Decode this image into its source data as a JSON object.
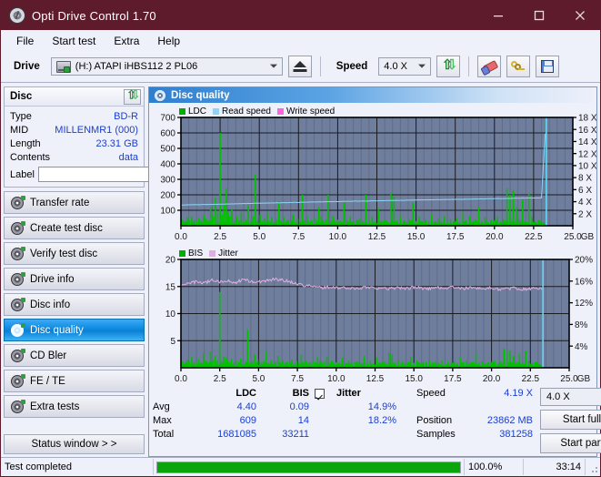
{
  "window": {
    "title": "Opti Drive Control 1.70",
    "icon": "disc-icon",
    "minimize": "minimize-icon",
    "maximize": "maximize-icon",
    "close": "close-icon"
  },
  "menu": {
    "items": [
      "File",
      "Start test",
      "Extra",
      "Help"
    ]
  },
  "toolbar": {
    "drive_label": "Drive",
    "drive_value": "(H:)  ATAPI iHBS112  2 PL06",
    "eject_icon": "eject-icon",
    "speed_label": "Speed",
    "speed_value": "4.0 X",
    "refresh_icon": "refresh-arrows-icon",
    "erase_icon": "eraser-icon",
    "keys_icon": "keys-icon",
    "save_icon": "floppy-save-icon"
  },
  "disc": {
    "header": "Disc",
    "refresh_icon": "refresh-arrows-icon",
    "rows": [
      {
        "label": "Type",
        "value": "BD-R"
      },
      {
        "label": "MID",
        "value": "MILLENMR1 (000)"
      },
      {
        "label": "Length",
        "value": "23.31 GB"
      },
      {
        "label": "Contents",
        "value": "data"
      }
    ],
    "label_label": "Label",
    "label_value": "",
    "label_placeholder": "",
    "disc_button_icon": "cd-disc-icon"
  },
  "sidebar": {
    "items": [
      {
        "label": "Transfer rate",
        "active": false
      },
      {
        "label": "Create test disc",
        "active": false
      },
      {
        "label": "Verify test disc",
        "active": false
      },
      {
        "label": "Drive info",
        "active": false
      },
      {
        "label": "Disc info",
        "active": false
      },
      {
        "label": "Disc quality",
        "active": true
      },
      {
        "label": "CD Bler",
        "active": false
      },
      {
        "label": "FE / TE",
        "active": false
      },
      {
        "label": "Extra tests",
        "active": false
      }
    ],
    "status_window": "Status window > >"
  },
  "main": {
    "title": "Disc quality",
    "icon": "disc-quality-icon"
  },
  "stats": {
    "col_headers": [
      "LDC",
      "BIS"
    ],
    "jitter_label": "Jitter",
    "jitter_checked": true,
    "rows": [
      {
        "label": "Avg",
        "ldc": "4.40",
        "bis": "0.09",
        "jitter": "14.9%"
      },
      {
        "label": "Max",
        "ldc": "609",
        "bis": "14",
        "jitter": "18.2%"
      },
      {
        "label": "Total",
        "ldc": "1681085",
        "bis": "33211",
        "jitter": ""
      }
    ],
    "speed_label": "Speed",
    "speed_value": "4.19 X",
    "position_label": "Position",
    "position_value": "23862 MB",
    "samples_label": "Samples",
    "samples_value": "381258",
    "speed_select": "4.0 X",
    "start_full": "Start full",
    "start_part": "Start part"
  },
  "statusbar": {
    "message": "Test completed",
    "progress_percent": "100.0%",
    "progress_value": 100,
    "elapsed": "33:14"
  },
  "colors": {
    "titlebar": "#5e1b2c",
    "accent": "#0a8ae0",
    "ldc": "#00c000",
    "bis": "#00c000",
    "read_speed": "#8fd4f5",
    "write_speed": "#ff66dd",
    "jitter": "#e8b6e8",
    "plot_bg": "#6e7e9c",
    "value_text": "#1a3fd0",
    "progress": "#0aa50a"
  },
  "chart_data": [
    {
      "type": "bar",
      "name": "ldc-chart",
      "title": "",
      "legend": [
        {
          "label": "LDC",
          "color": "#00b000"
        },
        {
          "label": "Read speed",
          "color": "#8fd4f5"
        },
        {
          "label": "Write speed",
          "color": "#ff66dd"
        }
      ],
      "legend_position": "top-left",
      "xlabel": "GB",
      "ylabel": "",
      "xlim": [
        0,
        25
      ],
      "ylim": [
        0,
        700
      ],
      "y2lim": [
        0,
        18
      ],
      "y2label": "X",
      "xticks": [
        "0.0",
        "2.5",
        "5.0",
        "7.5",
        "10.0",
        "12.5",
        "15.0",
        "17.5",
        "20.0",
        "22.5",
        "25.0"
      ],
      "yticks": [
        100,
        200,
        300,
        400,
        500,
        600,
        700
      ],
      "y2ticks": [
        "2 X",
        "4 X",
        "6 X",
        "8 X",
        "10 X",
        "12 X",
        "14 X",
        "16 X",
        "18 X"
      ],
      "grid": true,
      "data_end_gb": 23.31,
      "series": [
        {
          "name": "LDC",
          "kind": "bars",
          "color": "#00c000",
          "x": [
            0.1,
            0.25,
            0.4,
            0.55,
            0.7,
            0.85,
            1.0,
            1.15,
            1.3,
            1.45,
            1.6,
            1.75,
            1.9,
            2.05,
            2.2,
            2.35,
            2.5,
            2.62,
            2.75,
            2.9,
            3.0,
            3.1,
            3.25,
            3.4,
            3.55,
            3.7,
            3.85,
            4.0,
            4.15,
            4.3,
            4.45,
            4.6,
            4.75,
            4.9,
            5.05,
            5.2,
            5.35,
            5.5,
            5.65,
            5.8,
            5.95,
            6.1,
            6.25,
            6.4,
            6.55,
            6.7,
            6.85,
            7.0,
            7.15,
            7.3,
            7.45,
            7.6,
            7.75,
            7.9,
            8.05,
            8.2,
            8.35,
            8.5,
            8.65,
            8.8,
            8.95,
            9.1,
            9.25,
            9.4,
            9.55,
            9.7,
            9.85,
            10.0,
            10.2,
            10.4,
            10.6,
            10.8,
            11.0,
            11.2,
            11.4,
            11.6,
            11.8,
            12.0,
            12.2,
            12.4,
            12.6,
            12.8,
            13.0,
            13.2,
            13.4,
            13.6,
            13.8,
            14.0,
            14.2,
            14.4,
            14.6,
            14.8,
            15.0,
            15.2,
            15.4,
            15.6,
            15.8,
            16.0,
            16.2,
            16.4,
            16.6,
            16.8,
            17.0,
            17.2,
            17.4,
            17.6,
            17.8,
            18.0,
            18.2,
            18.4,
            18.6,
            18.8,
            19.0,
            19.2,
            19.4,
            19.6,
            19.8,
            20.0,
            20.2,
            20.4,
            20.6,
            20.8,
            21.0,
            21.2,
            21.4,
            21.6,
            21.8,
            22.0,
            22.2,
            22.4,
            22.6,
            22.8,
            23.0,
            23.2
          ],
          "values": [
            40,
            30,
            55,
            35,
            60,
            40,
            30,
            50,
            35,
            70,
            45,
            30,
            120,
            60,
            180,
            90,
            600,
            70,
            150,
            240,
            90,
            60,
            110,
            35,
            60,
            30,
            90,
            25,
            40,
            130,
            30,
            60,
            330,
            40,
            70,
            25,
            50,
            90,
            30,
            55,
            25,
            40,
            160,
            30,
            60,
            25,
            40,
            30,
            70,
            25,
            45,
            30,
            200,
            40,
            60,
            30,
            25,
            50,
            35,
            120,
            60,
            25,
            40,
            200,
            35,
            60,
            25,
            40,
            30,
            150,
            35,
            60,
            25,
            40,
            50,
            30,
            200,
            35,
            60,
            25,
            110,
            30,
            40,
            25,
            210,
            190,
            35,
            60,
            30,
            25,
            40,
            150,
            30,
            60,
            25,
            40,
            30,
            70,
            25,
            45,
            30,
            60,
            25,
            40,
            30,
            50,
            25,
            90,
            35,
            60,
            25,
            40,
            120,
            30,
            55,
            25,
            40,
            30,
            60,
            25,
            40,
            240,
            200,
            230,
            120,
            40,
            170,
            30,
            210,
            60,
            25,
            40
          ]
        },
        {
          "name": "Read speed",
          "kind": "line",
          "color": "#8fd4f5",
          "axis": "y2",
          "x": [
            0.0,
            1.0,
            2.0,
            3.0,
            4.0,
            5.0,
            6.0,
            7.0,
            8.0,
            9.0,
            10.0,
            11.0,
            12.0,
            13.0,
            14.0,
            15.0,
            16.0,
            17.0,
            18.0,
            19.0,
            20.0,
            21.0,
            22.0,
            23.0,
            23.3
          ],
          "values": [
            3.45,
            3.5,
            3.55,
            3.62,
            3.68,
            3.75,
            3.8,
            3.86,
            3.92,
            3.98,
            4.02,
            4.08,
            4.12,
            4.18,
            4.22,
            4.28,
            4.32,
            4.36,
            4.4,
            4.45,
            4.5,
            4.55,
            4.6,
            4.62,
            18.0
          ]
        }
      ]
    },
    {
      "type": "bar",
      "name": "bis-jitter-chart",
      "title": "",
      "legend": [
        {
          "label": "BIS",
          "color": "#00b000"
        },
        {
          "label": "Jitter",
          "color": "#e0aee0"
        }
      ],
      "legend_position": "top-left",
      "xlabel": "GB",
      "ylabel": "",
      "xlim": [
        0,
        25
      ],
      "ylim": [
        0,
        20
      ],
      "y2lim": [
        0,
        20
      ],
      "y2label": "%",
      "xticks": [
        "0.0",
        "2.5",
        "5.0",
        "7.5",
        "10.0",
        "12.5",
        "15.0",
        "17.5",
        "20.0",
        "22.5",
        "25.0"
      ],
      "yticks": [
        5,
        10,
        15,
        20
      ],
      "y2ticks": [
        "4%",
        "8%",
        "12%",
        "16%",
        "20%"
      ],
      "grid": true,
      "data_end_gb": 23.31,
      "series": [
        {
          "name": "BIS",
          "kind": "bars",
          "color": "#00c000",
          "x": [
            0.1,
            0.25,
            0.4,
            0.55,
            0.7,
            0.85,
            1.0,
            1.15,
            1.3,
            1.45,
            1.6,
            1.75,
            1.9,
            2.05,
            2.2,
            2.35,
            2.5,
            2.62,
            2.75,
            2.9,
            3.0,
            3.1,
            3.25,
            3.4,
            3.55,
            3.7,
            3.85,
            4.0,
            4.15,
            4.3,
            4.45,
            4.6,
            4.75,
            4.9,
            5.05,
            5.2,
            5.35,
            5.5,
            5.65,
            5.8,
            5.95,
            6.1,
            6.25,
            6.4,
            6.55,
            6.7,
            6.85,
            7.0,
            7.15,
            7.3,
            7.45,
            7.6,
            7.75,
            7.9,
            8.05,
            8.2,
            8.35,
            8.5,
            8.65,
            8.8,
            8.95,
            9.1,
            9.25,
            9.4,
            9.55,
            9.7,
            9.85,
            10.0,
            10.2,
            10.4,
            10.6,
            10.8,
            11.0,
            11.2,
            11.4,
            11.6,
            11.8,
            12.0,
            12.2,
            12.4,
            12.6,
            12.8,
            13.0,
            13.2,
            13.4,
            13.6,
            13.8,
            14.0,
            14.2,
            14.4,
            14.6,
            14.8,
            15.0,
            15.2,
            15.4,
            15.6,
            15.8,
            16.0,
            16.2,
            16.4,
            16.6,
            16.8,
            17.0,
            17.2,
            17.4,
            17.6,
            17.8,
            18.0,
            18.2,
            18.4,
            18.6,
            18.8,
            19.0,
            19.2,
            19.4,
            19.6,
            19.8,
            20.0,
            20.2,
            20.4,
            20.6,
            20.8,
            21.0,
            21.2,
            21.4,
            21.6,
            21.8,
            22.0,
            22.2,
            22.4,
            22.6,
            22.8,
            23.0,
            23.2
          ],
          "values": [
            1.2,
            0.8,
            1.5,
            1.0,
            2.0,
            1.1,
            0.9,
            1.6,
            1.0,
            2.6,
            1.3,
            0.9,
            3.0,
            1.5,
            2.2,
            1.4,
            14.0,
            1.2,
            2.0,
            1.9,
            1.3,
            1.0,
            1.6,
            0.9,
            1.4,
            0.8,
            1.7,
            0.8,
            1.1,
            7.0,
            0.9,
            1.3,
            2.5,
            1.0,
            1.5,
            0.8,
            1.2,
            3.0,
            0.9,
            1.4,
            0.8,
            1.1,
            2.2,
            0.9,
            1.3,
            0.8,
            1.0,
            0.9,
            1.5,
            0.8,
            1.2,
            0.9,
            2.4,
            1.0,
            1.3,
            0.9,
            0.8,
            1.2,
            1.0,
            2.0,
            1.3,
            0.8,
            1.1,
            2.1,
            0.9,
            1.3,
            0.8,
            1.0,
            0.9,
            1.9,
            0.9,
            1.3,
            0.8,
            1.0,
            1.2,
            0.9,
            2.2,
            0.9,
            1.3,
            0.8,
            1.9,
            0.9,
            1.0,
            0.8,
            2.8,
            2.5,
            0.9,
            1.3,
            0.9,
            0.8,
            1.0,
            2.0,
            0.9,
            1.3,
            0.8,
            1.0,
            0.9,
            1.5,
            0.8,
            1.1,
            0.9,
            1.3,
            0.8,
            1.0,
            0.9,
            1.2,
            0.8,
            1.9,
            1.0,
            1.3,
            0.8,
            1.0,
            2.6,
            0.9,
            1.2,
            0.8,
            1.0,
            0.9,
            1.3,
            0.8,
            1.0,
            3.5,
            3.0,
            3.2,
            2.2,
            1.0,
            2.6,
            0.9,
            3.1,
            1.3,
            0.8,
            1.0
          ]
        },
        {
          "name": "Jitter",
          "kind": "line",
          "color": "#e0aee0",
          "axis": "y2",
          "x": [
            0.0,
            0.5,
            1.0,
            1.5,
            2.0,
            2.5,
            3.0,
            3.5,
            4.0,
            4.5,
            5.0,
            5.5,
            6.0,
            6.5,
            7.0,
            7.5,
            8.0,
            8.5,
            9.0,
            9.5,
            10.0,
            10.5,
            11.0,
            11.5,
            12.0,
            12.5,
            13.0,
            13.5,
            14.0,
            14.5,
            15.0,
            15.5,
            16.0,
            16.5,
            17.0,
            17.5,
            18.0,
            18.5,
            19.0,
            19.5,
            20.0,
            20.5,
            21.0,
            21.5,
            22.0,
            22.5,
            23.0,
            23.3
          ],
          "values": [
            15.4,
            15.5,
            15.9,
            15.6,
            16.2,
            15.8,
            16.0,
            15.7,
            16.3,
            15.9,
            15.8,
            16.1,
            16.4,
            16.2,
            15.9,
            15.5,
            15.2,
            15.0,
            14.8,
            14.9,
            14.7,
            14.8,
            14.6,
            14.7,
            14.9,
            14.8,
            14.6,
            14.7,
            14.8,
            14.6,
            14.9,
            14.7,
            14.6,
            14.8,
            14.7,
            14.9,
            14.6,
            14.7,
            14.8,
            14.6,
            14.7,
            14.5,
            14.6,
            14.7,
            14.5,
            14.6,
            14.7,
            14.5
          ]
        }
      ]
    }
  ]
}
